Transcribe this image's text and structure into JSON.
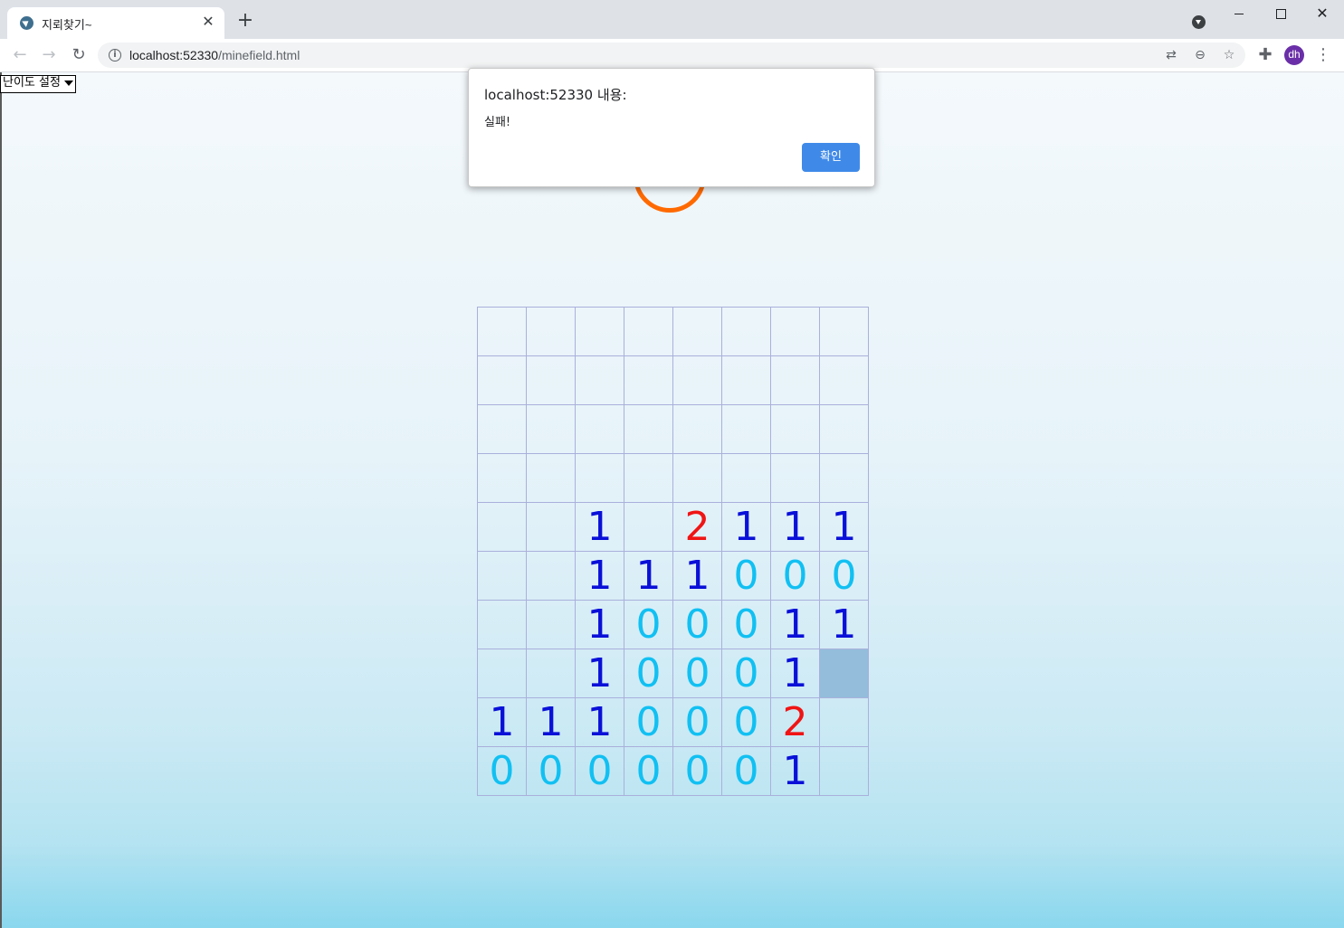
{
  "browser": {
    "tab_title": "지뢰찾기~",
    "tab_close": "✕",
    "new_tab": "+",
    "url_host": "localhost:52330",
    "url_path": "/minefield.html",
    "avatar_initials": "dh",
    "icons": [
      "back-arrow",
      "forward-arrow",
      "reload",
      "info",
      "translate",
      "zoom-out",
      "star",
      "extensions",
      "menu"
    ]
  },
  "page": {
    "difficulty_select": {
      "selected": "난이도 설정"
    },
    "board": {
      "rows": [
        [
          "",
          "",
          "",
          "",
          "",
          "",
          "",
          ""
        ],
        [
          "",
          "",
          "",
          "",
          "",
          "",
          "",
          ""
        ],
        [
          "",
          "",
          "",
          "",
          "",
          "",
          "",
          ""
        ],
        [
          "",
          "",
          "",
          "",
          "",
          "",
          "",
          ""
        ],
        [
          "",
          "",
          "1",
          "",
          "2",
          "1",
          "1",
          "1"
        ],
        [
          "",
          "",
          "1",
          "1",
          "1",
          "0",
          "0",
          "0"
        ],
        [
          "",
          "",
          "1",
          "0",
          "0",
          "0",
          "1",
          "1"
        ],
        [
          "",
          "",
          "1",
          "0",
          "0",
          "0",
          "1",
          ""
        ],
        [
          "1",
          "1",
          "1",
          "0",
          "0",
          "0",
          "2",
          ""
        ],
        [
          "0",
          "0",
          "0",
          "0",
          "0",
          "0",
          "1",
          ""
        ]
      ],
      "hit_cell": {
        "row": 7,
        "col": 7
      },
      "colors": {
        "zero": "#11c0f2",
        "one": "#0a10d8",
        "two": "#f01414",
        "hit": "#93bddb"
      }
    },
    "reset_button_color": "#ff6a00"
  },
  "dialog": {
    "title": "localhost:52330 내용:",
    "message": "실패!",
    "ok_label": "확인",
    "ok_color": "#3f8ae8"
  }
}
